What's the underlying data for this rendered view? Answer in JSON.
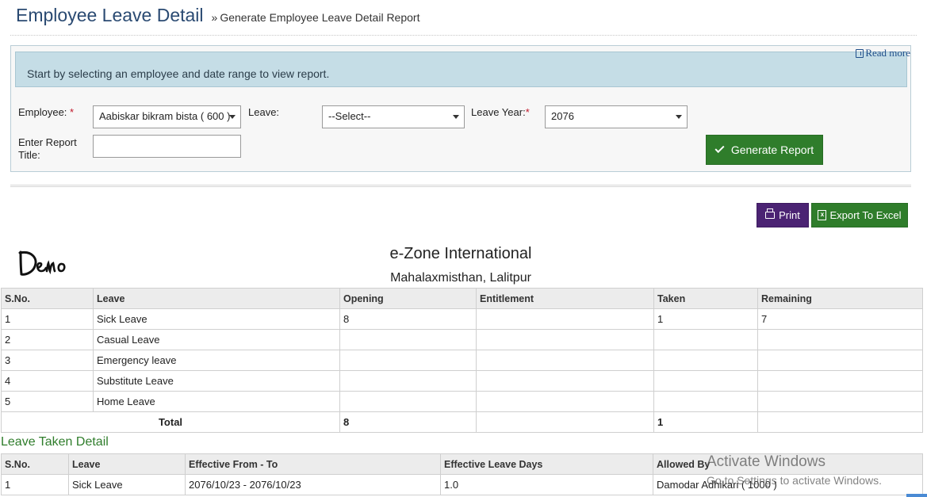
{
  "header": {
    "title": "Employee Leave Detail",
    "breadcrumb_sep": "»",
    "breadcrumb": "Generate Employee Leave Detail Report"
  },
  "panel": {
    "read_more": "Read more",
    "info": "Start by selecting an employee and date range to view report.",
    "employee_label": "Employee:",
    "required_mark": "*",
    "employee_value": "Aabiskar bikram bista ( 600 )",
    "leave_label": "Leave:",
    "leave_value": "--Select--",
    "leave_year_label": "Leave Year:",
    "leave_year_value": "2076",
    "report_title_label_1": "Enter Report",
    "report_title_label_2": "Title:",
    "report_title_value": "",
    "generate_button": "Generate Report"
  },
  "actions": {
    "print": "Print",
    "export": "Export To Excel"
  },
  "report": {
    "logo_text": "Demo",
    "company": "e-Zone International",
    "address": "Mahalaxmisthan, Lalitpur",
    "columns": [
      "S.No.",
      "Leave",
      "Opening",
      "Entitlement",
      "Taken",
      "Remaining"
    ],
    "rows": [
      {
        "sno": "1",
        "leave": "Sick Leave",
        "opening": "8",
        "entitlement": "",
        "taken": "1",
        "remaining": "7"
      },
      {
        "sno": "2",
        "leave": "Casual Leave",
        "opening": "",
        "entitlement": "",
        "taken": "",
        "remaining": ""
      },
      {
        "sno": "3",
        "leave": "Emergency leave",
        "opening": "",
        "entitlement": "",
        "taken": "",
        "remaining": ""
      },
      {
        "sno": "4",
        "leave": "Substitute Leave",
        "opening": "",
        "entitlement": "",
        "taken": "",
        "remaining": ""
      },
      {
        "sno": "5",
        "leave": "Home Leave",
        "opening": "",
        "entitlement": "",
        "taken": "",
        "remaining": ""
      }
    ],
    "total": {
      "label": "Total",
      "opening": "8",
      "taken": "1"
    }
  },
  "taken_detail": {
    "title": "Leave Taken Detail",
    "columns": [
      "S.No.",
      "Leave",
      "Effective From - To",
      "Effective Leave Days",
      "Allowed By"
    ],
    "rows": [
      {
        "sno": "1",
        "leave": "Sick Leave",
        "range": "2076/10/23 - 2076/10/23",
        "days": "1.0",
        "allowed_by": "Damodar Adhikari ( 1000 )"
      }
    ]
  },
  "watermark": {
    "line1": "Activate Windows",
    "line2": "Go to Settings to activate Windows."
  },
  "colors": {
    "accent_green": "#2f7d2b",
    "print_purple": "#4b2373",
    "info_bg": "#c5dde6",
    "title_blue": "#2a4a72"
  }
}
